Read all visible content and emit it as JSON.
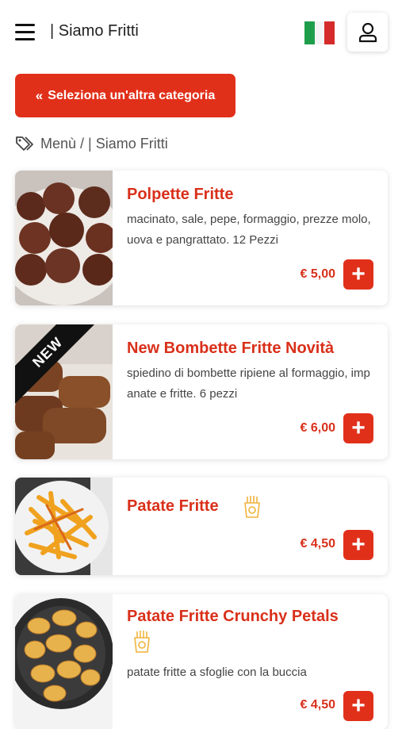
{
  "header": {
    "brand": "| Siamo Fritti",
    "flag_colors": [
      "#1e9e4a",
      "#ffffff",
      "#d52b2b"
    ]
  },
  "category_button": {
    "label": "Seleziona un'altra categoria",
    "icon": "double-chevron-left-icon"
  },
  "breadcrumb": {
    "text": "Menù / | Siamo Fritti",
    "icon": "tags-icon"
  },
  "products": [
    {
      "title": "Polpette Fritte",
      "description": "macinato, sale, pepe, formaggio, prezze molo, uova e pangrattato. 12 Pezzi",
      "price": "€ 5,00"
    },
    {
      "title": "New Bombette Fritte Novità",
      "description": "spiedino di bombette ripiene al formaggio, impanate e fritte. 6 pezzi",
      "price": "€ 6,00",
      "ribbon": "NEW"
    },
    {
      "title": "Patate Fritte",
      "price": "€ 4,50",
      "icon": "fries-icon"
    },
    {
      "title": "Patate Fritte Crunchy Petals",
      "description": "patate fritte a sfoglie con la buccia",
      "price": "€ 4,50",
      "icon": "fries-icon"
    }
  ],
  "colors": {
    "accent": "#e1301a",
    "title": "#d9301a",
    "icon_gold": "#f0b43c"
  }
}
